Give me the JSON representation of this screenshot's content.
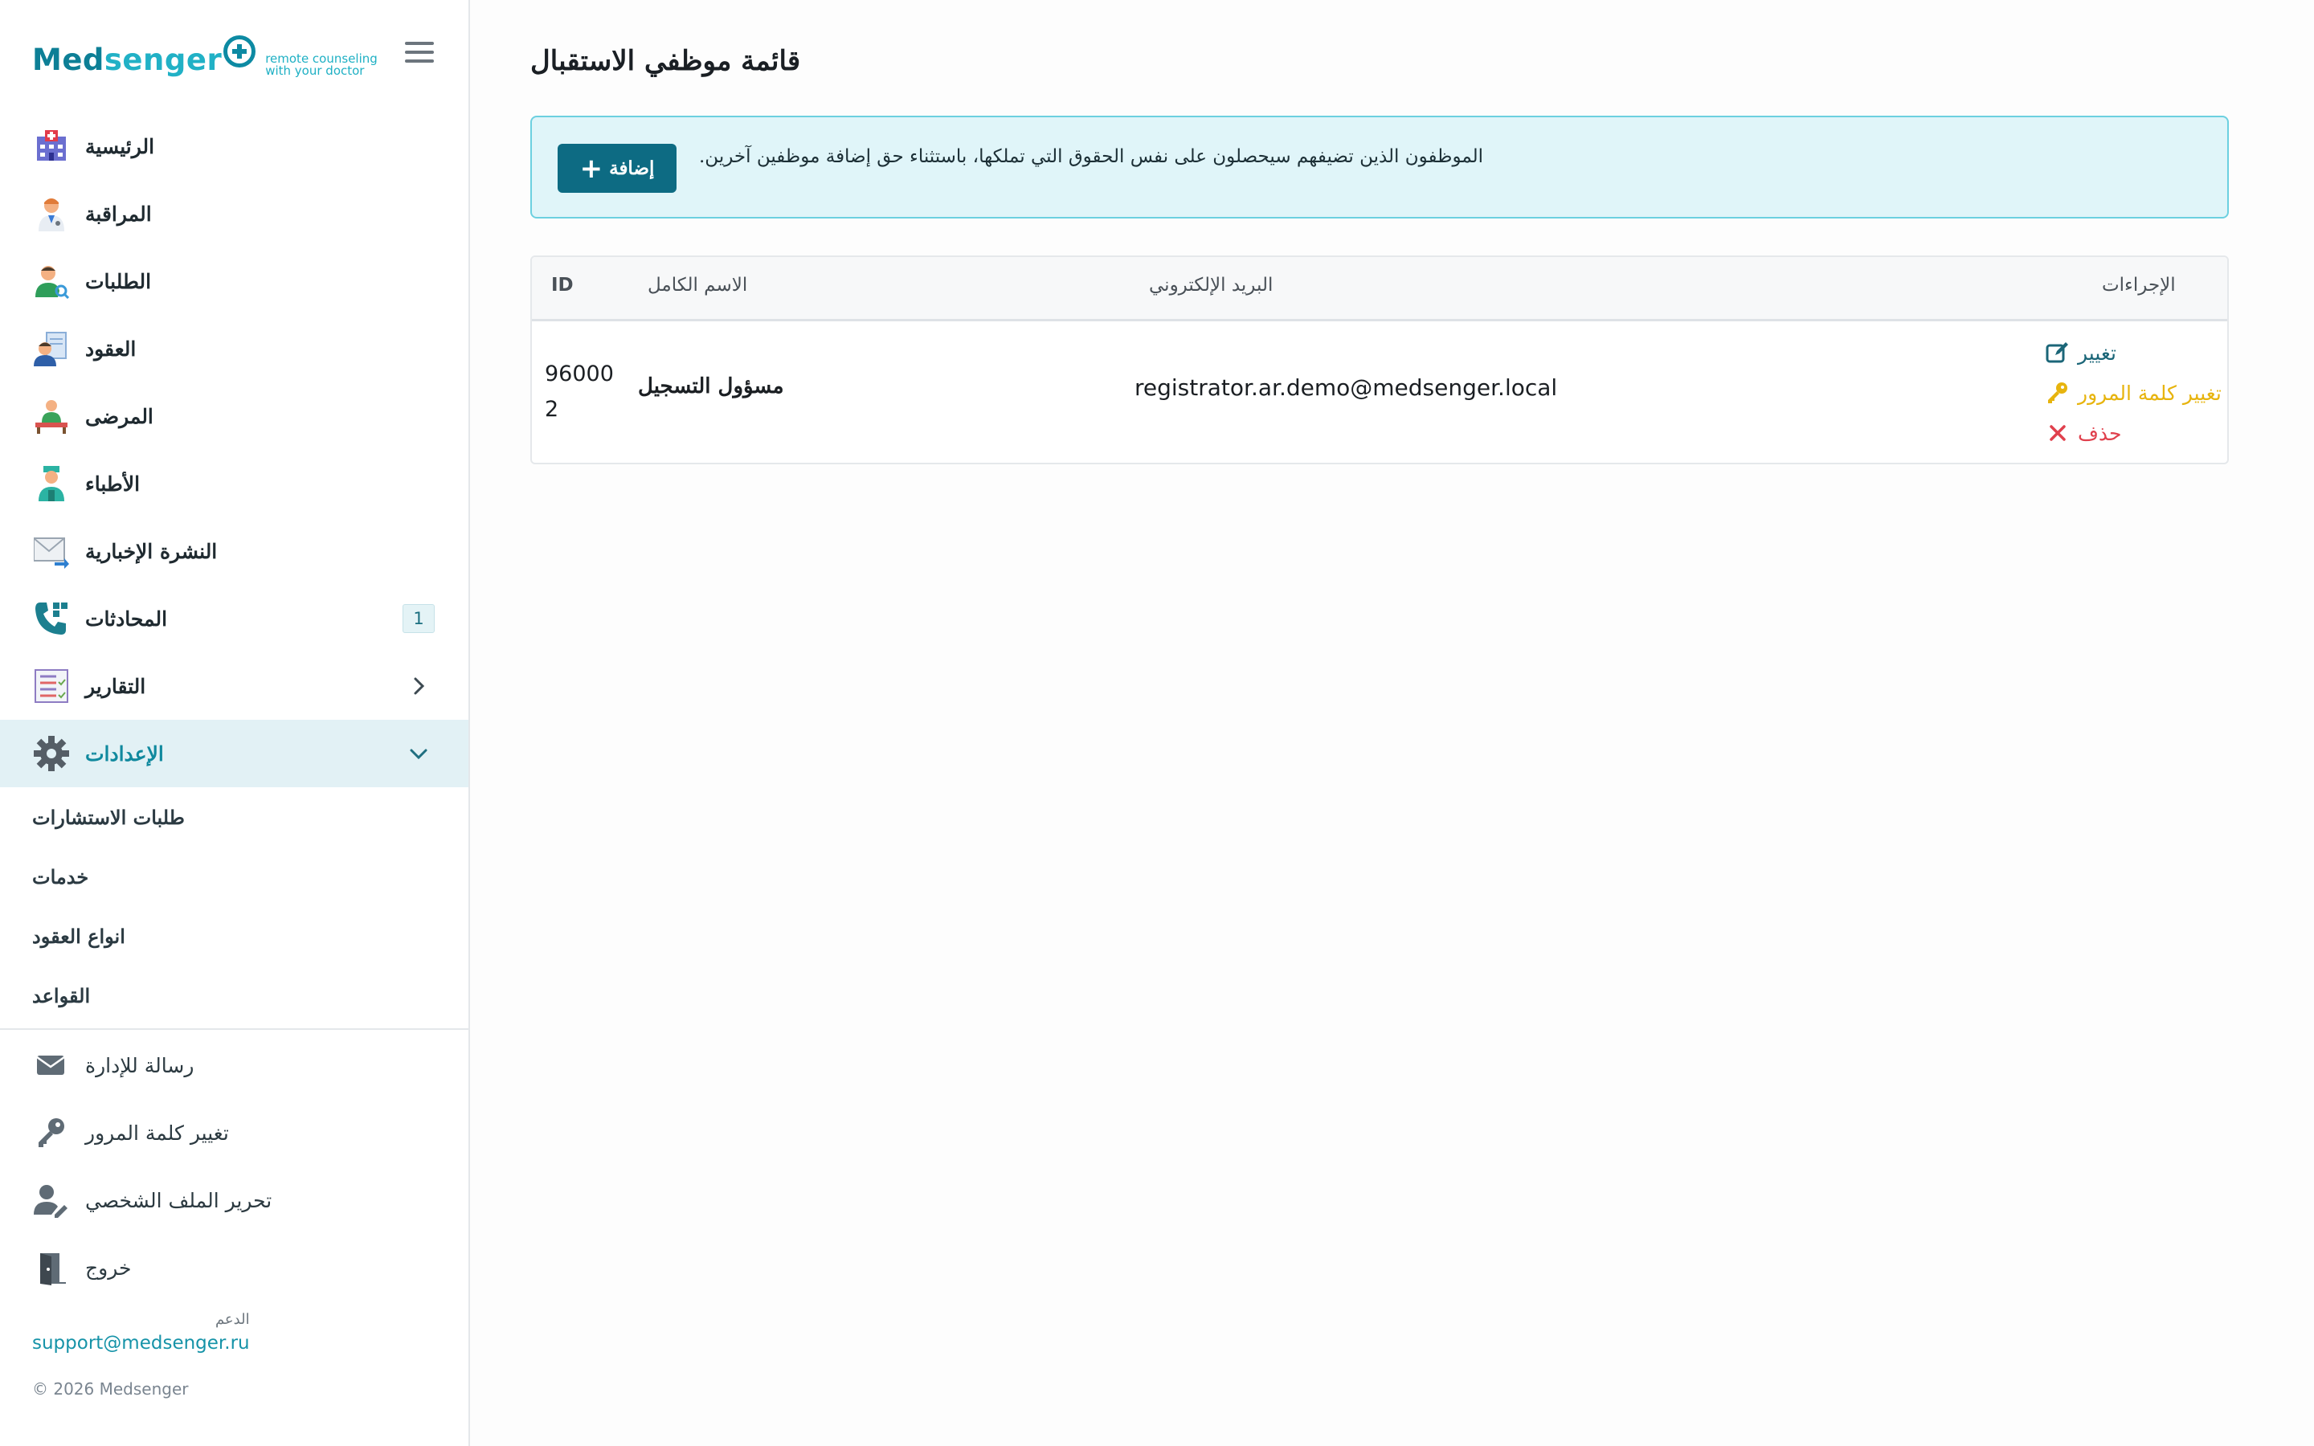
{
  "brand": {
    "logo_med": "Med",
    "logo_senger": "senger",
    "tagline_line1": "remote counseling",
    "tagline_line2": "with your doctor"
  },
  "sidebar": {
    "items": [
      {
        "label": "الرئيسية",
        "icon": "hospital-icon"
      },
      {
        "label": "المراقبة",
        "icon": "doctor-icon"
      },
      {
        "label": "الطلبات",
        "icon": "user-search-icon"
      },
      {
        "label": "العقود",
        "icon": "contract-icon"
      },
      {
        "label": "المرضى",
        "icon": "patients-icon"
      },
      {
        "label": "الأطباء",
        "icon": "nurse-icon"
      },
      {
        "label": "النشرة الإخبارية",
        "icon": "mail-send-icon"
      },
      {
        "label": "المحادثات",
        "icon": "phone-icon",
        "badge": "1"
      },
      {
        "label": "التقارير",
        "icon": "report-icon"
      },
      {
        "label": "الإعدادات",
        "icon": "gear-icon"
      }
    ],
    "settings_sub": [
      "طلبات الاستشارات",
      "خدمات",
      "انواع العقود",
      "القواعد"
    ],
    "bottom_items": [
      {
        "label": "رسالة للإدارة",
        "icon": "envelope-icon"
      },
      {
        "label": "تغيير كلمة المرور",
        "icon": "key-icon"
      },
      {
        "label": "تحرير الملف الشخصي",
        "icon": "user-edit-icon"
      },
      {
        "label": "خروج",
        "icon": "logout-door-icon"
      }
    ],
    "support_label": "الدعم",
    "support_email": "support@medsenger.ru",
    "copyright": "© 2026 Medsenger"
  },
  "page": {
    "title": "قائمة موظفي الاستقبال",
    "alert_text": "الموظفون الذين تضيفهم سيحصلون على نفس الحقوق التي تملكها، باستثناء حق إضافة موظفين آخرين.",
    "add_button": "إضافة"
  },
  "table": {
    "columns": [
      "ID",
      "الاسم الكامل",
      "البريد الإلكتروني",
      "الإجراءات"
    ],
    "rows": [
      {
        "id_line1": "96000",
        "id_line2": "2",
        "name": "مسؤول التسجيل",
        "email": "registrator.ar.demo@medsenger.local",
        "actions": {
          "edit": "تغيير",
          "password": "تغيير كلمة المرور",
          "delete": "حذف"
        }
      }
    ]
  },
  "colors": {
    "brand_dark": "#0d7f96",
    "brand_light": "#21b1c6",
    "active_bg": "#e2f1f5",
    "alert_bg": "#e0f5f9",
    "alert_border": "#6cd0e0",
    "button": "#0d6b83",
    "action_edit": "#1b6678",
    "action_password": "#e7b40e",
    "action_delete": "#e0404d"
  }
}
